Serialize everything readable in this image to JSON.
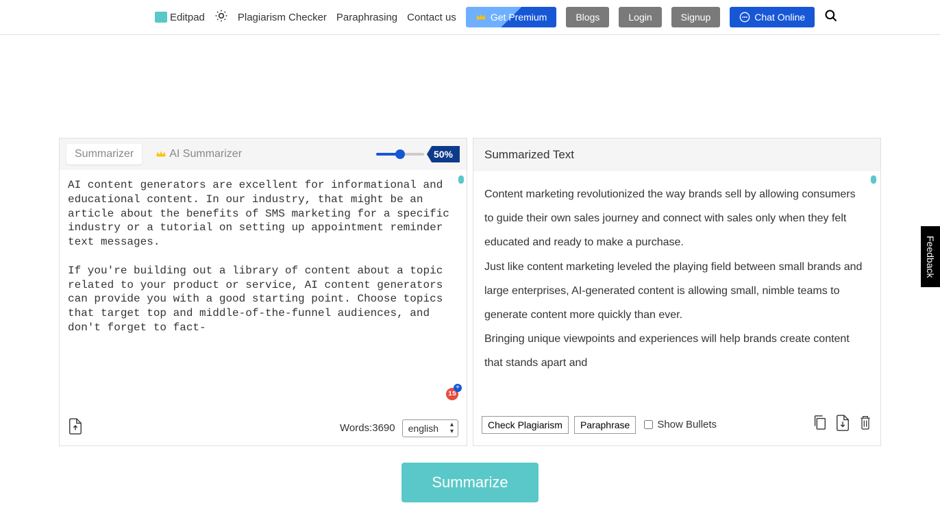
{
  "header": {
    "brand": "Editpad",
    "nav": {
      "plagiarism": "Plagiarism Checker",
      "paraphrasing": "Paraphrasing",
      "contact": "Contact us"
    },
    "buttons": {
      "premium": "Get Premium",
      "blogs": "Blogs",
      "login": "Login",
      "signup": "Signup",
      "chat": "Chat Online"
    }
  },
  "left_panel": {
    "tabs": {
      "summarizer": "Summarizer",
      "ai_summarizer": "AI Summarizer"
    },
    "slider_value": "50%",
    "input_text_p1": "AI content generators are excellent for informational and educational content. In our industry, that might be an article about the benefits of SMS marketing for a specific industry or a tutorial on setting up appointment reminder text messages.",
    "input_text_p2": "If you're building out a library of content about a topic related to your product or service, AI content generators can provide you with a good starting point. Choose topics that target top and middle-of-the-funnel audiences, and don't forget to fact-",
    "grammarly_count": "15",
    "word_count_label": "Words:",
    "word_count": "3690",
    "language": "english"
  },
  "right_panel": {
    "title": "Summarized Text",
    "output_p1": "Content marketing revolutionized the way brands sell by allowing consumers to guide their own sales journey and connect with sales only when they felt educated and ready to make a purchase.",
    "output_p2": "Just like content marketing leveled the playing field between small brands and large enterprises, AI-generated content is allowing small, nimble teams to generate content more quickly than ever.",
    "output_p3": "Bringing unique viewpoints and experiences will help brands create content that stands apart and",
    "buttons": {
      "check_plagiarism": "Check Plagiarism",
      "paraphrase": "Paraphrase",
      "show_bullets": "Show Bullets"
    }
  },
  "summarize_button": "Summarize",
  "feedback_tab": "Feedback"
}
